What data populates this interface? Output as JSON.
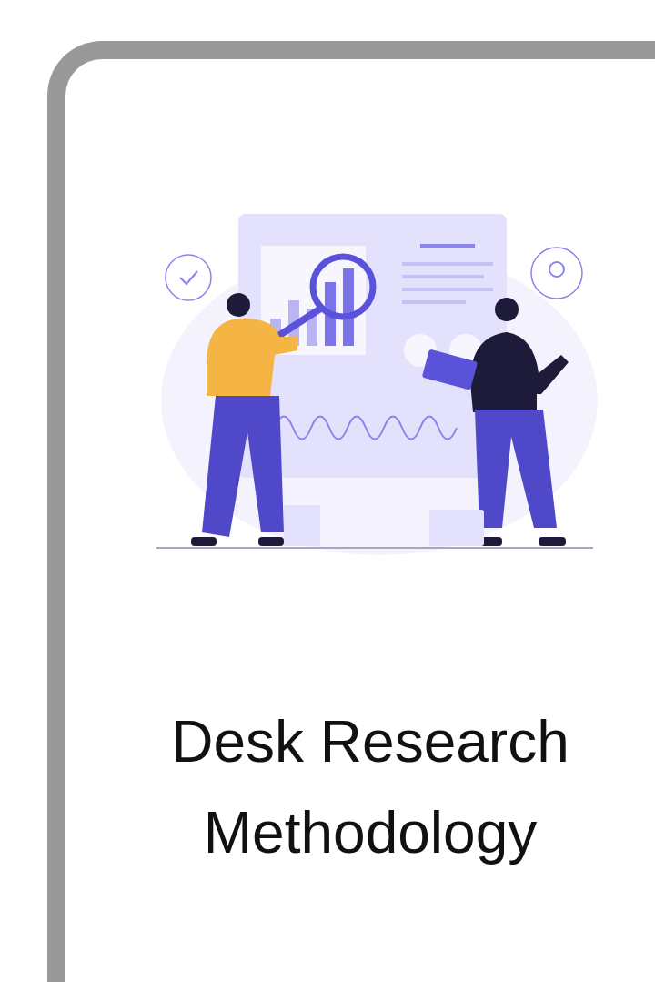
{
  "card": {
    "title": "Desk Research Methodology"
  }
}
